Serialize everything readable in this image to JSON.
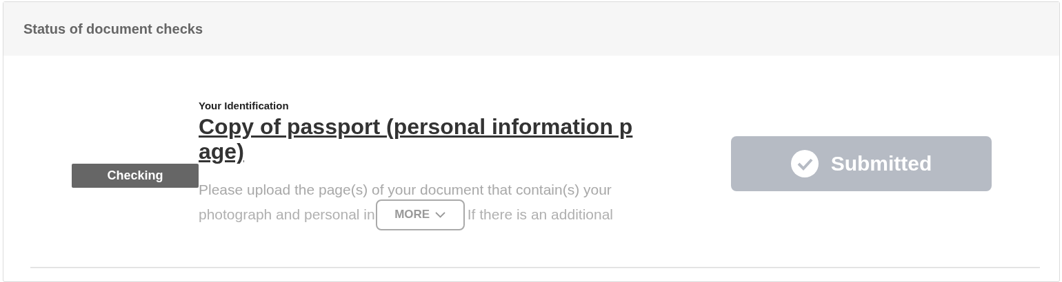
{
  "panel": {
    "title": "Status of document checks"
  },
  "documents": [
    {
      "status": "Checking",
      "category": "Your Identification",
      "title_lines": [
        "Copy of passport (personal information p",
        "age)"
      ],
      "description_line": "Please upload the page(s) of your document that contain(s) your",
      "description_before_more": "photograph and personal in",
      "more_label": "MORE",
      "description_after_more": "If there is an additional",
      "action": {
        "label": "Submitted",
        "disabled": true
      }
    }
  ]
}
